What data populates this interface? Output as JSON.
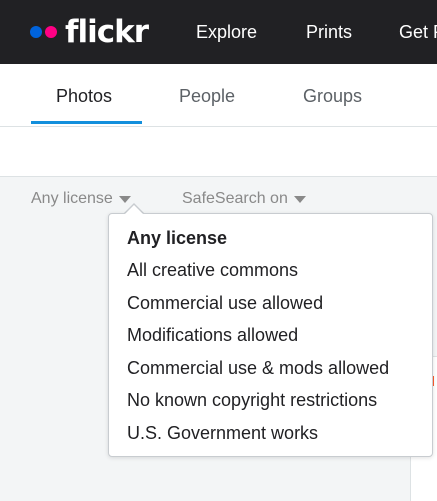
{
  "header": {
    "logo_text": "flickr",
    "logo_dot_colors": [
      "#0063dc",
      "#ff0084"
    ],
    "nav": [
      {
        "label": "Explore"
      },
      {
        "label": "Prints"
      },
      {
        "label": "Get P"
      }
    ]
  },
  "tabs": [
    {
      "label": "Photos",
      "active": true
    },
    {
      "label": "People",
      "active": false
    },
    {
      "label": "Groups",
      "active": false
    }
  ],
  "filters": {
    "license_label": "Any license",
    "safesearch_label": "SafeSearch on"
  },
  "license_menu": {
    "selected": "Any license",
    "options": [
      {
        "label": "Any license"
      },
      {
        "label": "All creative commons"
      },
      {
        "label": "Commercial use allowed"
      },
      {
        "label": "Modifications allowed"
      },
      {
        "label": "Commercial use & mods allowed"
      },
      {
        "label": "No known copyright restrictions"
      },
      {
        "label": "U.S. Government works"
      }
    ]
  },
  "colors": {
    "nav_bg": "#212124",
    "accent": "#128fdc"
  }
}
